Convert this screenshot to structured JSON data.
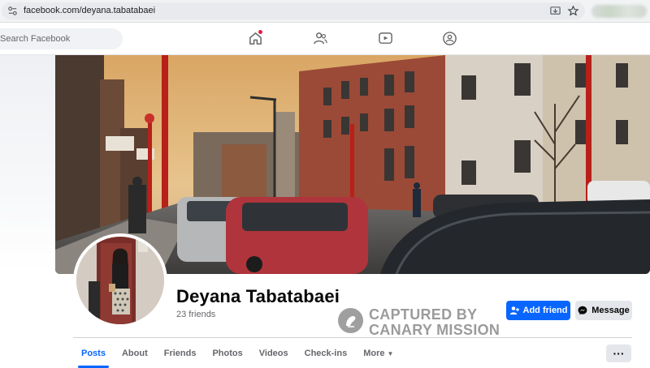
{
  "browser": {
    "url": "facebook.com/deyana.tabatabaei"
  },
  "header": {
    "search_placeholder": "Search Facebook",
    "nav_icons": [
      "home-icon",
      "friends-icon",
      "watch-icon",
      "groups-icon"
    ]
  },
  "profile": {
    "name": "Deyana Tabatabaei",
    "friends": "23 friends"
  },
  "actions": {
    "add_friend": "Add friend",
    "message": "Message",
    "more": "···"
  },
  "watermark": {
    "line1": "CAPTURED BY",
    "line2": "CANARY MISSION"
  },
  "tabs": [
    {
      "label": "Posts"
    },
    {
      "label": "About"
    },
    {
      "label": "Friends"
    },
    {
      "label": "Photos"
    },
    {
      "label": "Videos"
    },
    {
      "label": "Check-ins"
    },
    {
      "label": "More"
    }
  ],
  "colors": {
    "brand_blue": "#0866ff",
    "notification_red": "#e41e3f"
  }
}
